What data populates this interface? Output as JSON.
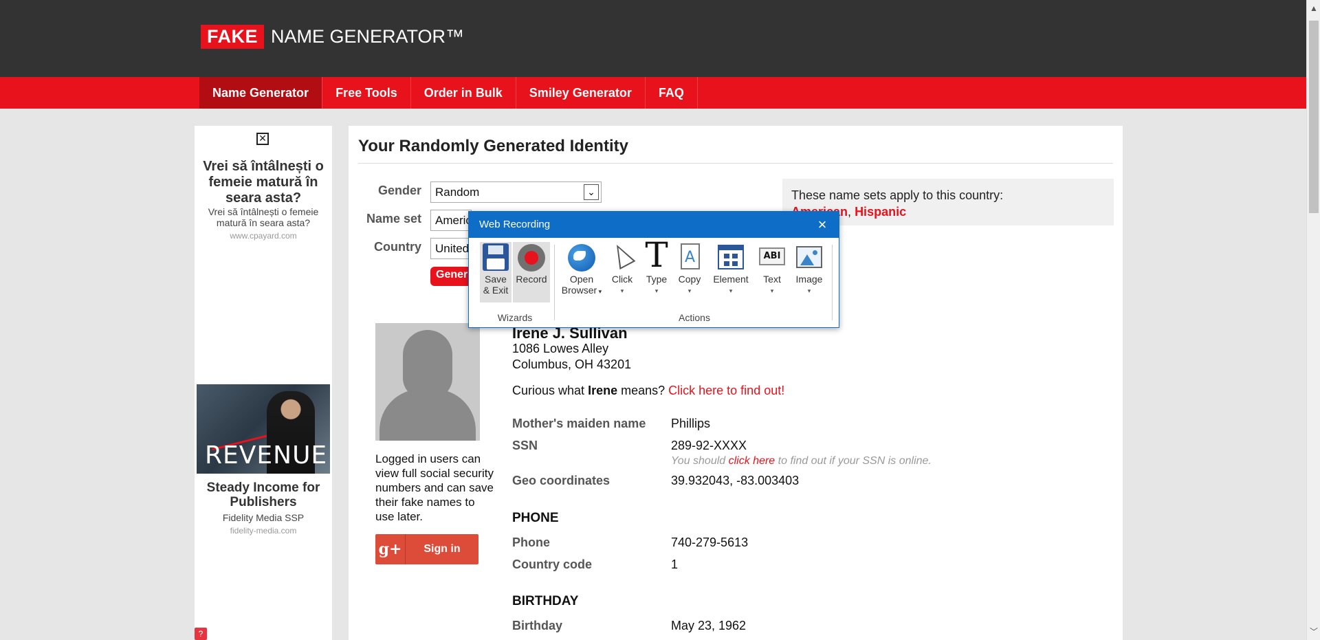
{
  "header": {
    "logo_fake": "FAKE",
    "logo_rest": "NAME GENERATOR™"
  },
  "nav": {
    "items": [
      {
        "label": "Name Generator",
        "active": true
      },
      {
        "label": "Free Tools"
      },
      {
        "label": "Order in Bulk"
      },
      {
        "label": "Smiley Generator"
      },
      {
        "label": "FAQ"
      }
    ]
  },
  "sidebar_ads": {
    "ad1": {
      "title": "Vrei să întâlnești o femeie matură în seara asta?",
      "subtitle": "Vrei să întâlnești o femeie matură în seara asta?",
      "url": "www.cpayard.com"
    },
    "ad2": {
      "image_text": "REVENUE",
      "title": "Steady Income for Publishers",
      "subtitle": "Fidelity Media SSP",
      "url": "fidelity-media.com"
    },
    "help": "?"
  },
  "main": {
    "title": "Your Randomly Generated Identity",
    "form": {
      "gender_label": "Gender",
      "gender_value": "Random",
      "nameset_label": "Name set",
      "nameset_value": "Americ",
      "country_label": "Country",
      "country_value": "United",
      "generate_label": "Gener"
    },
    "nameset_box": {
      "text": "These name sets apply to this country:",
      "links": [
        "American",
        "Hispanic"
      ],
      "separator": ", "
    },
    "login_note": "Logged in users can view full social security numbers and can save their fake names to use later.",
    "signin": {
      "icon": "g+",
      "label": "Sign in"
    },
    "person": {
      "name": "Irene J. Sullivan",
      "address_line1": "1086 Lowes Alley",
      "address_line2": "Columbus, OH 43201",
      "curious_prefix": "Curious what ",
      "curious_name": "Irene",
      "curious_mid": " means? ",
      "curious_link": "Click here to find out!"
    },
    "details": {
      "maiden_label": "Mother's maiden name",
      "maiden_value": "Phillips",
      "ssn_label": "SSN",
      "ssn_value": "289-92-XXXX",
      "ssn_note_prefix": "You should ",
      "ssn_note_link": "click here",
      "ssn_note_suffix": " to find out if your SSN is online.",
      "geo_label": "Geo coordinates",
      "geo_value": "39.932043, -83.003403",
      "phone_section": "PHONE",
      "phone_label": "Phone",
      "phone_value": "740-279-5613",
      "cc_label": "Country code",
      "cc_value": "1",
      "birthday_section": "BIRTHDAY",
      "birthday_label": "Birthday",
      "birthday_value": "May 23, 1962"
    }
  },
  "web_recording": {
    "title": "Web Recording",
    "close_icon": "×",
    "buttons": {
      "save_exit": "Save\n& Exit",
      "record": "Record",
      "open_browser_1": "Open",
      "open_browser_2": "Browser",
      "click": "Click",
      "type": "Type",
      "copy": "Copy",
      "element": "Element",
      "text": "Text",
      "image": "Image",
      "type_icon_glyph": "T",
      "text_icon_glyph": "ABI"
    },
    "groups": {
      "wizards": "Wizards",
      "actions": "Actions"
    }
  },
  "scrollbar": {
    "up": "▲",
    "down": "﹀"
  },
  "colors": {
    "brand_red": "#e8121c",
    "header_dark": "#333333",
    "dialog_blue": "#0e6ec7"
  }
}
